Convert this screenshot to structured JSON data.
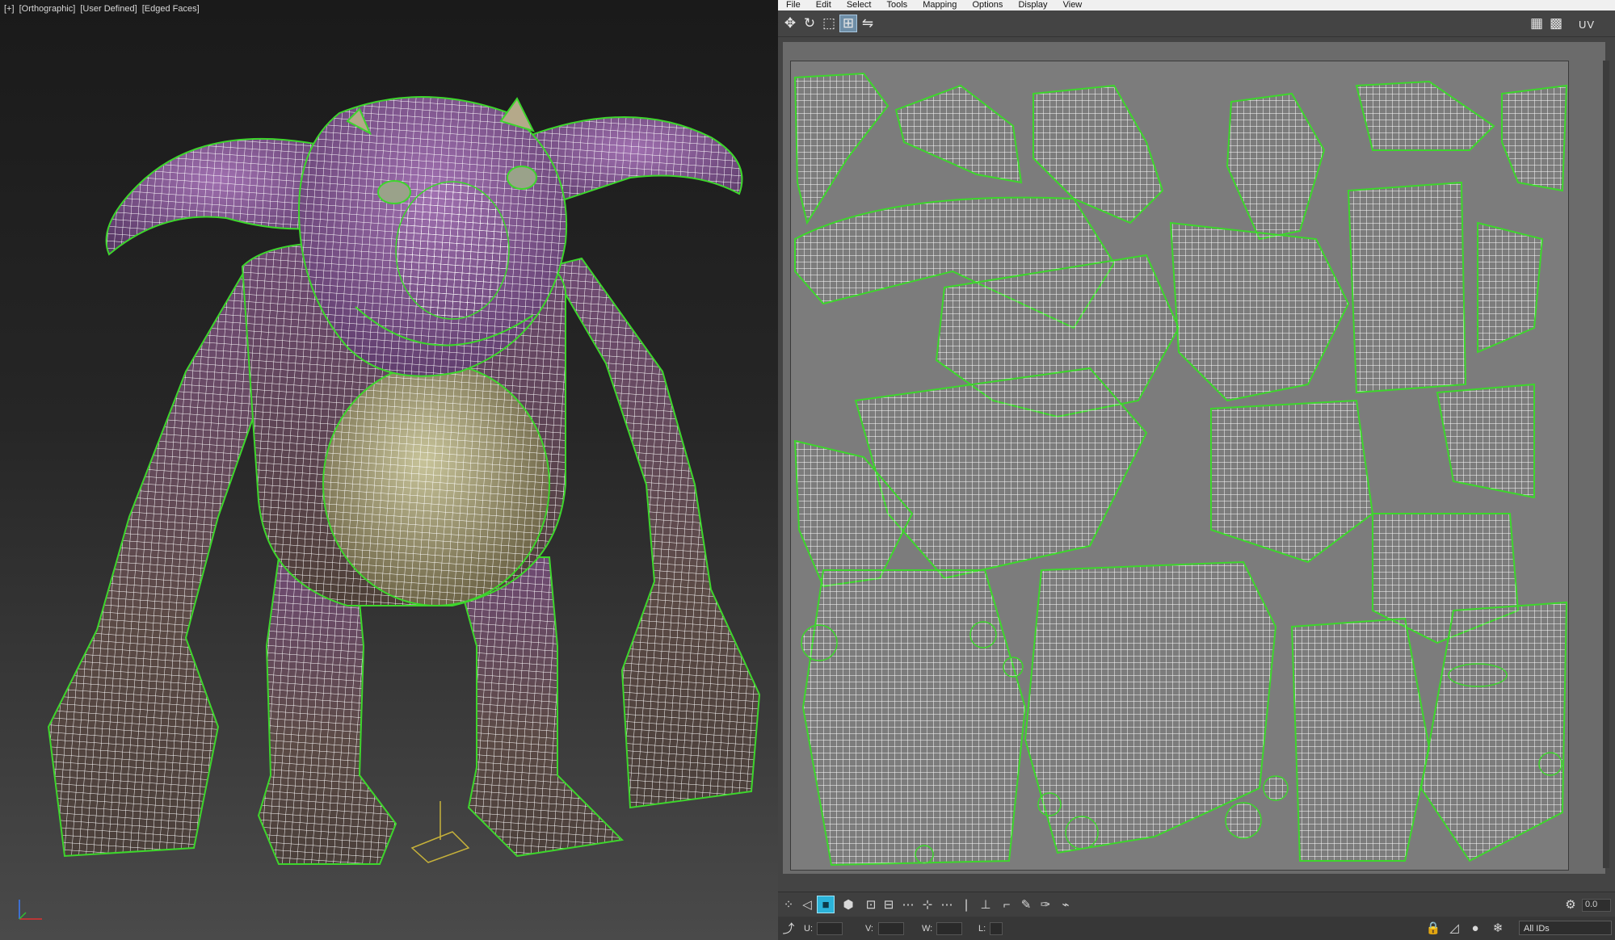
{
  "viewport": {
    "labels": [
      "[+]",
      "[Orthographic]",
      "[User Defined]",
      "[Edged Faces]"
    ]
  },
  "uv_editor": {
    "menu": [
      "File",
      "Edit",
      "Select",
      "Tools",
      "Mapping",
      "Options",
      "Display",
      "View"
    ],
    "uv_label": "UV",
    "spinner_value": "0.0",
    "status": {
      "u_label": "U:",
      "v_label": "V:",
      "w_label": "W:",
      "l_label": "L:",
      "ids_select": "All IDs"
    }
  },
  "colors": {
    "seam": "#3dd62c",
    "wire": "#ffffff",
    "skin_purple": "#7a4a7c",
    "skin_brown": "#5a4a3c",
    "uv_bg": "#7c7c7c",
    "selection_blue": "#2bb3d9"
  },
  "icons": {
    "top_left": [
      "move-icon",
      "rotate-icon",
      "scale-icon",
      "freeform-icon",
      "mirror-icon"
    ],
    "top_right": [
      "checker-grid-icon",
      "checker-texture-icon"
    ],
    "bottom": [
      "vertex-select-icon",
      "edge-select-icon",
      "face-select-icon",
      "element-select-icon",
      "grow-icon",
      "shrink-icon",
      "loop-icon",
      "ring-icon",
      "edge-loop-icon",
      "pin-icon",
      "align-icon",
      "paint-icon",
      "brush-icon",
      "soft-select-icon"
    ]
  }
}
